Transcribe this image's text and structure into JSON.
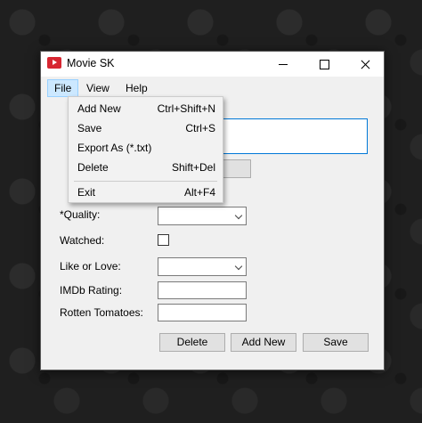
{
  "window": {
    "title": "Movie SK",
    "app_icon": "movie-player-icon",
    "controls": [
      "minimize-icon",
      "maximize-icon",
      "close-icon"
    ]
  },
  "menubar": {
    "file": "File",
    "view": "View",
    "help": "Help"
  },
  "file_menu": {
    "items": [
      {
        "label": "Add New",
        "shortcut": "Ctrl+Shift+N"
      },
      {
        "label": "Save",
        "shortcut": "Ctrl+S"
      },
      {
        "label": "Export As (*.txt)",
        "shortcut": ""
      },
      {
        "label": "Delete",
        "shortcut": "Shift+Del"
      },
      {
        "label": "Exit",
        "shortcut": "Alt+F4"
      }
    ]
  },
  "form": {
    "quality_label": "*Quality:",
    "quality_value": "",
    "watched_label": "Watched:",
    "watched_checked": false,
    "like_label": "Like or Love:",
    "like_value": "",
    "imdb_label": "IMDb Rating:",
    "imdb_value": "",
    "rt_label": "Rotten Tomatoes:",
    "rt_value": ""
  },
  "buttons": {
    "delete": "Delete",
    "add_new": "Add New",
    "save": "Save"
  },
  "colors": {
    "menu_highlight": "#cce8ff",
    "focus_border": "#0078d7",
    "app_icon": "#d72631"
  }
}
